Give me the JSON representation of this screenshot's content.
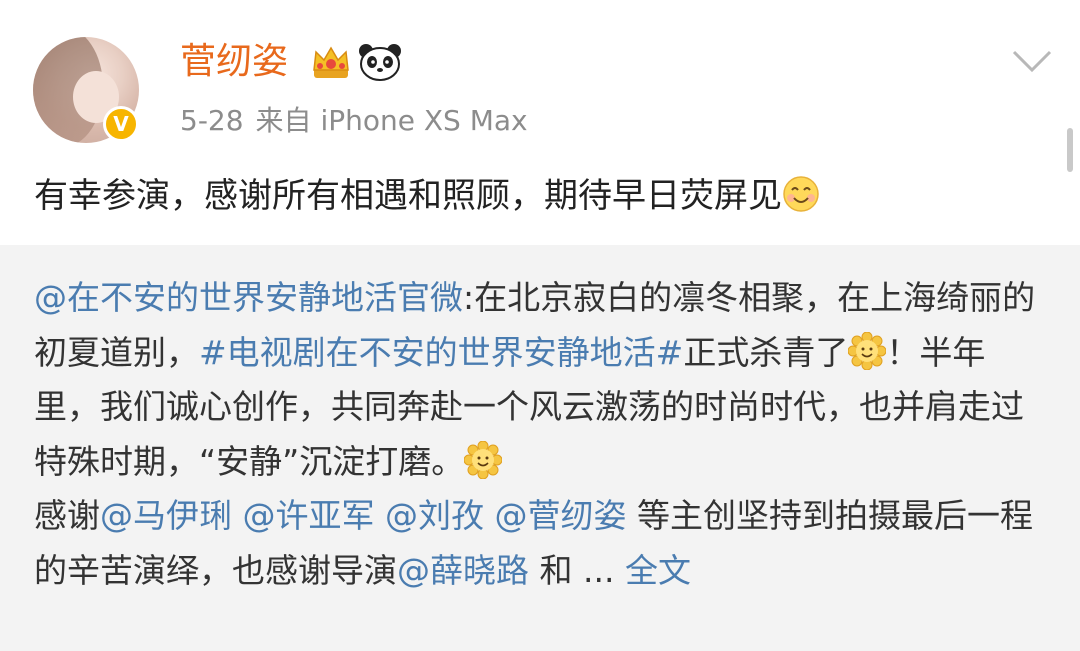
{
  "user": {
    "name": "菅纫姿",
    "date": "5-28",
    "source": "来自 iPhone XS Max",
    "verified_mark": "V"
  },
  "post": {
    "text": "有幸参演，感谢所有相遇和照顾，期待早日荧屏见"
  },
  "repost": {
    "author": "@在不安的世界安静地活官微",
    "seg1": ":在北京寂白的凛冬相聚，在上海绮丽的初夏道别，",
    "hashtag": "#电视剧在不安的世界安静地活#",
    "seg2": "正式杀青了",
    "seg3": "！半年里，我们诚心创作，共同奔赴一个风云激荡的时尚时代，也并肩走过特殊时期，“安静”沉淀打磨。",
    "seg4": "感谢",
    "mention1": "@马伊琍",
    "mention2": "@许亚军",
    "mention3": "@刘孜",
    "mention4": "@菅纫姿",
    "seg5": " 等主创坚持到拍摄最后一程的辛苦演绎，也感谢导演",
    "mention5": "@薛晓路",
    "seg6": " 和 ... ",
    "full_text": "全文"
  },
  "colors": {
    "username": "#e8691c",
    "link": "#4a7cb0",
    "meta": "#8c8c8c",
    "repost_bg": "#f3f3f3",
    "badge": "#f7b500"
  },
  "icons": [
    "crown-icon",
    "panda-icon",
    "chevron-down-icon",
    "smile-icon",
    "sun-icon",
    "verified-badge-icon"
  ]
}
